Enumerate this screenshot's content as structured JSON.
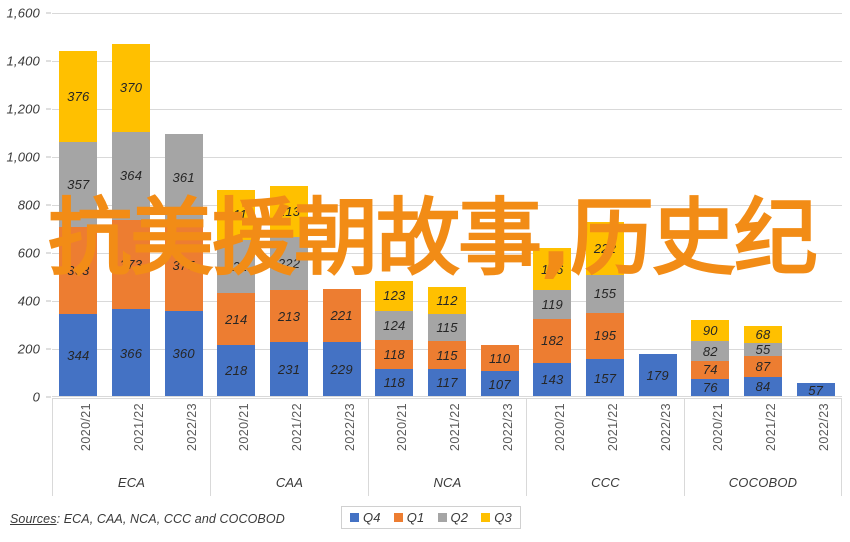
{
  "overlay": {
    "text": "抗美援朝故事,历史纪",
    "color": "#F28C16"
  },
  "sources": {
    "label": "Sources",
    "separator": ": ",
    "text": "ECA, CAA, NCA, CCC and COCOBOD"
  },
  "legend": {
    "position": "bottom-center",
    "items": [
      {
        "label": "Q4",
        "color": "#4472C4"
      },
      {
        "label": "Q1",
        "color": "#ED7D31"
      },
      {
        "label": "Q2",
        "color": "#A5A5A5"
      },
      {
        "label": "Q3",
        "color": "#FFC000"
      }
    ]
  },
  "chart_data": {
    "type": "bar",
    "subtype": "stacked",
    "title": "",
    "subtitle": "",
    "xlabel": "",
    "ylabel": "",
    "ylim": [
      0,
      1600
    ],
    "ytick_step": 200,
    "ytick_labels": [
      "0",
      "200",
      "400",
      "600",
      "800",
      "1,000",
      "1,200",
      "1,400",
      "1,600"
    ],
    "ytick_values": [
      0,
      200,
      400,
      600,
      800,
      1000,
      1200,
      1400,
      1600
    ],
    "grid": true,
    "groups": [
      "ECA",
      "CAA",
      "NCA",
      "CCC",
      "COCOBOD"
    ],
    "categories": [
      "2020/21",
      "2021/22",
      "2022/23"
    ],
    "series": [
      {
        "name": "Q4",
        "color": "#4472C4"
      },
      {
        "name": "Q1",
        "color": "#ED7D31"
      },
      {
        "name": "Q2",
        "color": "#A5A5A5"
      },
      {
        "name": "Q3",
        "color": "#FFC000"
      }
    ],
    "data": [
      {
        "group": "ECA",
        "bars": [
          {
            "category": "2020/21",
            "values": [
              344,
              363,
              357,
              376
            ],
            "labels": [
              "344",
              "363",
              "357",
              "376"
            ],
            "total": 1440
          },
          {
            "category": "2021/22",
            "values": [
              366,
              373,
              364,
              370
            ],
            "labels": [
              "366",
              "373",
              "364",
              "370"
            ],
            "total": 1473
          },
          {
            "category": "2022/23",
            "values": [
              360,
              375,
              361,
              0
            ],
            "labels": [
              "360",
              "375",
              "361",
              ""
            ],
            "total": 1096
          }
        ]
      },
      {
        "group": "CAA",
        "bars": [
          {
            "category": "2020/21",
            "values": [
              218,
              214,
              221,
              211
            ],
            "labels": [
              "218",
              "214",
              "221",
              "211"
            ],
            "total": 864
          },
          {
            "category": "2021/22",
            "values": [
              231,
              213,
              222,
              213
            ],
            "labels": [
              "231",
              "213",
              "222",
              "213"
            ],
            "total": 879
          },
          {
            "category": "2022/23",
            "values": [
              229,
              221,
              0,
              0
            ],
            "labels": [
              "229",
              "221",
              "",
              ""
            ],
            "total": 450
          }
        ]
      },
      {
        "group": "NCA",
        "bars": [
          {
            "category": "2020/21",
            "values": [
              118,
              118,
              124,
              123
            ],
            "labels": [
              "118",
              "118",
              "124",
              "123"
            ],
            "total": 483
          },
          {
            "category": "2021/22",
            "values": [
              117,
              115,
              115,
              112
            ],
            "labels": [
              "117",
              "115",
              "115",
              "112"
            ],
            "total": 459
          },
          {
            "category": "2022/23",
            "values": [
              107,
              110,
              0,
              0
            ],
            "labels": [
              "107",
              "110",
              "",
              ""
            ],
            "total": 217
          }
        ]
      },
      {
        "group": "CCC",
        "bars": [
          {
            "category": "2020/21",
            "values": [
              143,
              182,
              119,
              176
            ],
            "labels": [
              "143",
              "182",
              "119",
              "176"
            ],
            "total": 620
          },
          {
            "category": "2021/22",
            "values": [
              157,
              195,
              155,
              222
            ],
            "labels": [
              "157",
              "195",
              "155",
              "222"
            ],
            "total": 729
          },
          {
            "category": "2022/23",
            "values": [
              179,
              0,
              0,
              0
            ],
            "labels": [
              "179",
              "",
              "",
              ""
            ],
            "total": 179
          }
        ]
      },
      {
        "group": "COCOBOD",
        "bars": [
          {
            "category": "2020/21",
            "values": [
              76,
              74,
              82,
              90
            ],
            "labels": [
              "76",
              "74",
              "82",
              "90"
            ],
            "total": 322
          },
          {
            "category": "2021/22",
            "values": [
              84,
              87,
              55,
              68
            ],
            "labels": [
              "84",
              "87",
              "55",
              "68"
            ],
            "total": 294
          },
          {
            "category": "2022/23",
            "values": [
              57,
              0,
              0,
              0
            ],
            "labels": [
              "57",
              "",
              "",
              ""
            ],
            "total": 57
          }
        ]
      }
    ]
  }
}
